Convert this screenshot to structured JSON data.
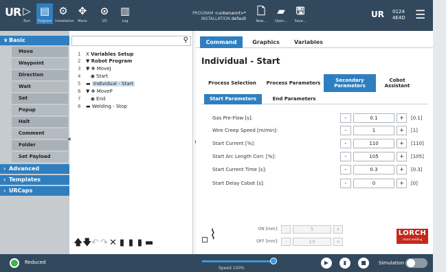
{
  "header": {
    "logo": "UR",
    "nav": [
      {
        "label": "Run",
        "glyph": "▷"
      },
      {
        "label": "Program",
        "glyph": "▤"
      },
      {
        "label": "Installation",
        "glyph": "⚙"
      },
      {
        "label": "Move",
        "glyph": "✥"
      },
      {
        "label": "I/O",
        "glyph": "⊙"
      },
      {
        "label": "Log",
        "glyph": "▥"
      }
    ],
    "program_label": "PROGRAM",
    "program_value": "<unbenannt>*",
    "installation_label": "INSTALLATION",
    "installation_value": "default",
    "file_actions": [
      {
        "label": "New...",
        "glyph": "🗋"
      },
      {
        "label": "Open...",
        "glyph": "▰"
      },
      {
        "label": "Save...",
        "glyph": "🖫"
      }
    ],
    "robot_badge": "UR",
    "clock_time": "0124",
    "clock_date": "4E4D",
    "menu_icon": "☰"
  },
  "sidebar": {
    "basic_label": "Basic",
    "items": [
      "Move",
      "Waypoint",
      "Direction",
      "Wait",
      "Set",
      "Popup",
      "Halt",
      "Comment",
      "Folder",
      "Set Payload"
    ],
    "categories": [
      "Advanced",
      "Templates",
      "URCaps"
    ]
  },
  "tree": {
    "search_placeholder": "",
    "rows": [
      {
        "n": "1",
        "mark": "X",
        "text": "Variables Setup",
        "bold": true
      },
      {
        "n": "2",
        "mark": "▼",
        "text": "Robot Program",
        "bold": true
      },
      {
        "n": "3",
        "mark": "▼ ✥",
        "text": "MoveJ",
        "bold": false
      },
      {
        "n": "4",
        "mark": "◉",
        "text": "Start",
        "bold": false
      },
      {
        "n": "5",
        "mark": "▬",
        "text": "Individual - Start",
        "bold": false
      },
      {
        "n": "6",
        "mark": "▼ ✥",
        "text": "MoveP",
        "bold": false
      },
      {
        "n": "7",
        "mark": "◉",
        "text": "End",
        "bold": false
      },
      {
        "n": "8",
        "mark": "▬",
        "text": "Welding - Stop",
        "bold": false
      }
    ],
    "tools": [
      "🡅",
      "🡇",
      "↶",
      "↷",
      "✕",
      "▮",
      "▮",
      "▮",
      "▬"
    ]
  },
  "main": {
    "tabs": [
      "Command",
      "Graphics",
      "Variables"
    ],
    "title": "Individual - Start",
    "process_tabs": [
      "Process Selection",
      "Process Parameters",
      "Secondary Parameters",
      "Cobot Assistant"
    ],
    "sub_tabs": [
      "Start Parameters",
      "End Parameters"
    ],
    "params": [
      {
        "label": "Gas Pre-Flow [s]:",
        "value": "0.1",
        "unit": "[0.1]"
      },
      {
        "label": "Wire Creep Speed [m/min]:",
        "value": "1",
        "unit": "[1]"
      },
      {
        "label": "Start Current [%]:",
        "value": "110",
        "unit": "[110]"
      },
      {
        "label": "Start Arc Length Corr. [%]:",
        "value": "105",
        "unit": "[105]"
      },
      {
        "label": "Start Current Time [s]:",
        "value": "0.3",
        "unit": "[0.3]"
      },
      {
        "label": "Start Delay Cobot [s]:",
        "value": "0",
        "unit": "[0]"
      }
    ],
    "minus_label": "-",
    "plus_label": "+",
    "torch": {
      "on_label": "ON [mm]:",
      "on_value": "5",
      "off_label": "OFF [mm]:",
      "off_value": "10"
    },
    "brand": "LORCH",
    "brand_sub": "smart welding"
  },
  "footer": {
    "status": "Reduced",
    "speed_label": "Speed 100%",
    "speed_percent": 100,
    "sim_label": "Simulation",
    "colors": {
      "status": "#3fb54a",
      "accent": "#2f7fc0",
      "header": "#32485c"
    }
  }
}
